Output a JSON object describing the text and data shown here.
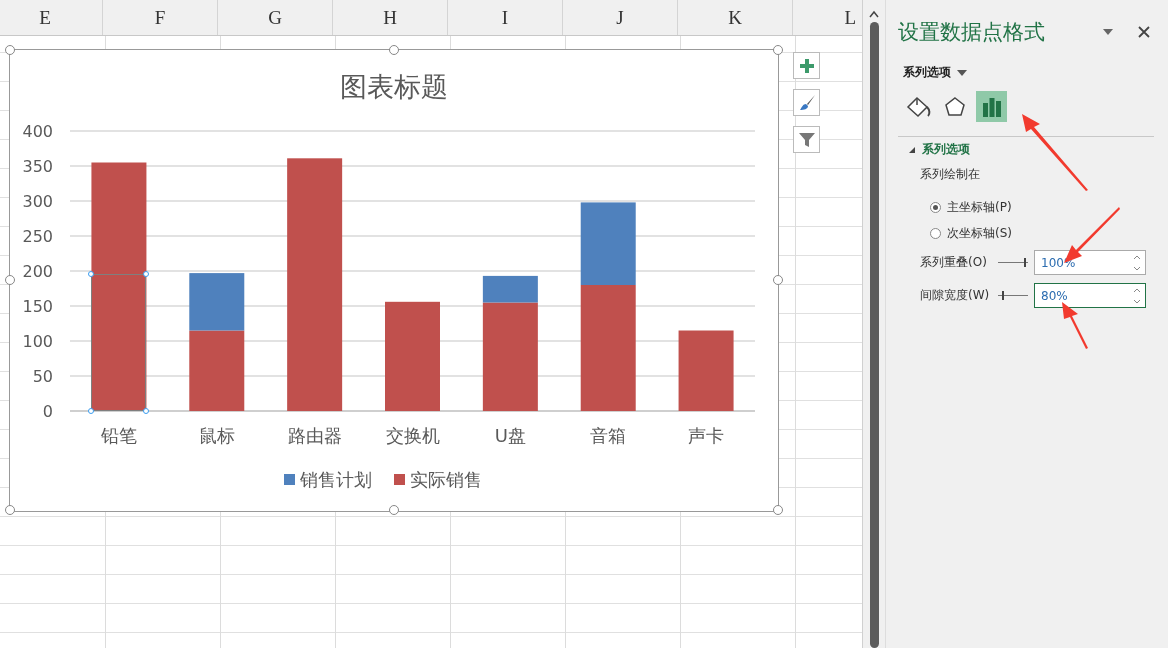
{
  "sheet": {
    "columns": [
      "E",
      "F",
      "G",
      "H",
      "I",
      "J",
      "K",
      "L"
    ]
  },
  "chart": {
    "chart_data": {
      "type": "bar",
      "title": "图表标题",
      "categories": [
        "铅笔",
        "鼠标",
        "路由器",
        "交换机",
        "U盘",
        "音箱",
        "声卡"
      ],
      "series": [
        {
          "name": "销售计划",
          "color": "#4f81bd",
          "values": [
            null,
            82,
            null,
            null,
            38,
            118,
            null
          ]
        },
        {
          "name": "实际销售",
          "color": "#c0504d",
          "values": [
            355,
            115,
            361,
            156,
            155,
            180,
            115
          ]
        }
      ],
      "ylim": [
        0,
        400
      ],
      "yticks": [
        0,
        50,
        100,
        150,
        200,
        250,
        300,
        350,
        400
      ],
      "stacked": true,
      "orientation": "vertical",
      "grid": true,
      "legend": true
    },
    "point_selected": true
  },
  "panel": {
    "title": "设置数据点格式",
    "dropdown": "系列选项",
    "tabs": [
      {
        "kind": "fill",
        "selected": false
      },
      {
        "kind": "effects",
        "selected": false
      },
      {
        "kind": "options",
        "selected": true
      }
    ],
    "section": {
      "title": "系列选项",
      "expanded": true,
      "label": "系列绘制在",
      "radios": [
        {
          "label": "主坐标轴(P)",
          "selected": true
        },
        {
          "label": "次坐标轴(S)",
          "selected": false
        }
      ],
      "fields": [
        {
          "label": "系列重叠(O)",
          "level": 1,
          "value": "100%",
          "focused": false
        },
        {
          "label": "间隙宽度(W)",
          "level": 0.16,
          "value": "80%",
          "focused": true
        }
      ]
    }
  }
}
